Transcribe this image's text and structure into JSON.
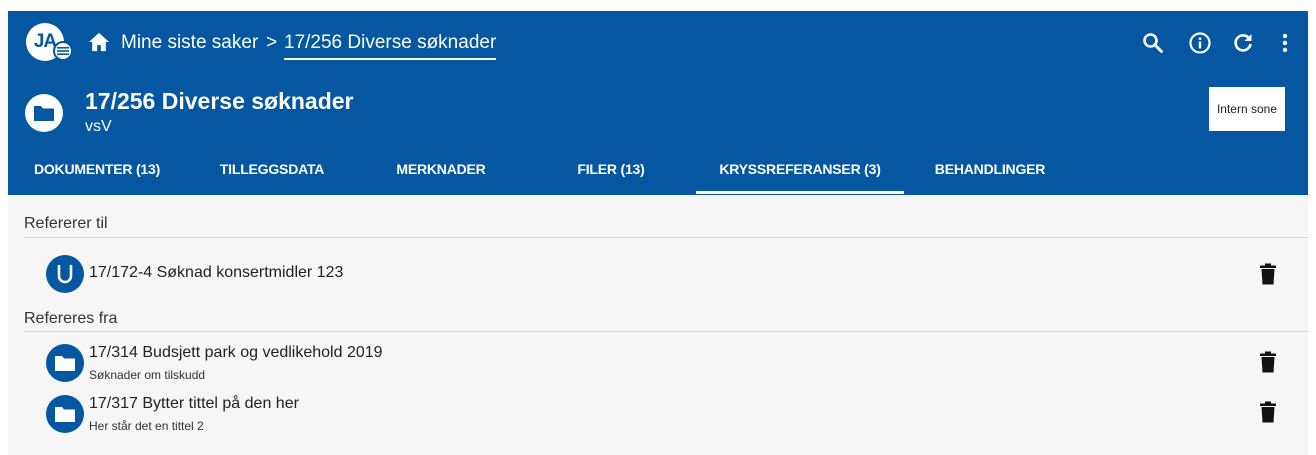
{
  "header": {
    "logo_text": "JA",
    "breadcrumb": {
      "home": "Mine siste saker",
      "separator": ">",
      "current": "17/256 Diverse søknader"
    },
    "icons": [
      "search-icon",
      "info-icon",
      "refresh-icon",
      "more-vert-icon"
    ],
    "case_title": "17/256 Diverse søknader",
    "case_subtitle": "vsV",
    "zone_button": "Intern sone",
    "accent_color": "#0457a0"
  },
  "tabs": [
    {
      "label": "DOKUMENTER (13)",
      "active": false
    },
    {
      "label": "TILLEGGSDATA",
      "active": false
    },
    {
      "label": "MERKNADER",
      "active": false
    },
    {
      "label": "FILER (13)",
      "active": false
    },
    {
      "label": "KRYSSREFERANSER (3)",
      "active": true
    },
    {
      "label": "BEHANDLINGER",
      "active": false
    }
  ],
  "refers_to": {
    "heading": "Refererer til",
    "items": [
      {
        "icon": "u-letter-icon",
        "title": "17/172-4 Søknad konsertmidler 123"
      }
    ]
  },
  "referred_from": {
    "heading": "Refereres fra",
    "items": [
      {
        "icon": "folder-icon",
        "title": "17/314 Budsjett park og vedlikehold 2019",
        "subtitle": "Søknader om tilskudd"
      },
      {
        "icon": "folder-icon",
        "title": "17/317 Bytter tittel på den her",
        "subtitle": "Her står det en tittel 2"
      }
    ]
  }
}
